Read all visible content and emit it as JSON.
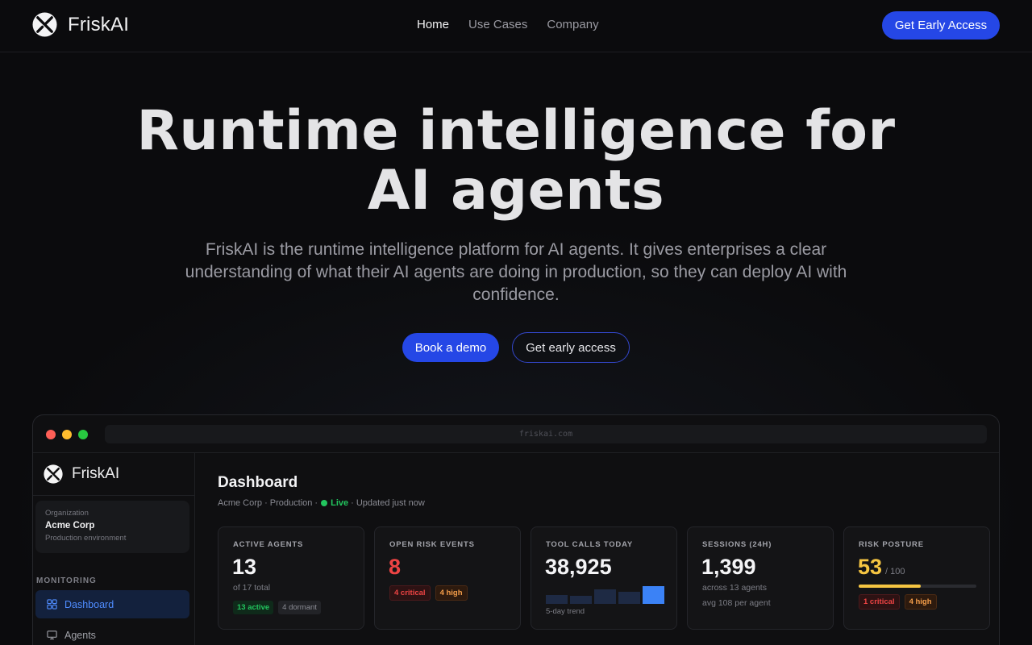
{
  "nav": {
    "brand": "FriskAI",
    "links": [
      {
        "label": "Home",
        "active": true
      },
      {
        "label": "Use Cases",
        "active": false
      },
      {
        "label": "Company",
        "active": false
      }
    ],
    "cta": "Get Early Access"
  },
  "hero": {
    "title_line1": "Runtime intelligence for",
    "title_line2": "AI agents",
    "subtitle": "FriskAI is the runtime intelligence platform for AI agents. It gives enterprises a clear understanding of what their AI agents are doing in production, so they can deploy AI with confidence.",
    "primary_button": "Book a demo",
    "secondary_button": "Get early access"
  },
  "window": {
    "url": "friskai.com",
    "traffic_lights": {
      "red": "#fe5f57",
      "yellow": "#febc2e",
      "green": "#28c840"
    }
  },
  "sidebar": {
    "brand": "FriskAI",
    "org": {
      "label": "Organization",
      "name": "Acme Corp",
      "env": "Production environment"
    },
    "section": "MONITORING",
    "items": [
      {
        "label": "Dashboard",
        "icon": "grid-icon",
        "active": true
      },
      {
        "label": "Agents",
        "icon": "monitor-icon",
        "active": false
      }
    ]
  },
  "dashboard": {
    "title": "Dashboard",
    "meta_prefix": "Acme Corp · Production ·",
    "live": "Live",
    "meta_suffix": "· Updated just now",
    "cards": [
      {
        "label": "ACTIVE AGENTS",
        "value": "13",
        "sub": "of 17 total",
        "badges": [
          "13 active",
          "4 dormant"
        ]
      },
      {
        "label": "OPEN RISK EVENTS",
        "value": "8",
        "badges": [
          "4 critical",
          "4 high"
        ]
      },
      {
        "label": "TOOL CALLS TODAY",
        "value": "38,925",
        "sub": "5-day trend",
        "trend": [
          0.5,
          0.45,
          0.8,
          0.7,
          1.0
        ]
      },
      {
        "label": "SESSIONS (24H)",
        "value": "1,399",
        "sub": "across 13 agents",
        "sub2": "avg 108 per agent"
      },
      {
        "label": "RISK POSTURE",
        "value": "53",
        "of": "/ 100",
        "score": 53,
        "badges": [
          "1 critical",
          "4 high"
        ]
      }
    ]
  },
  "colors": {
    "accent": "#2547e6",
    "live_green": "#22c55e",
    "critical_red": "#ef4444",
    "high_orange": "#f59e4a",
    "risk_gold": "#f5c542",
    "trend_dim": "#1e2a44",
    "trend_bright": "#3b82f6"
  }
}
